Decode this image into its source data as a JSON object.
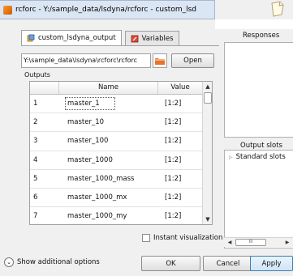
{
  "window": {
    "title": "rcforc - Y:/sample_data/lsdyna/rcforc - custom_lsd"
  },
  "tabs": [
    {
      "label": "custom_lsdyna_output",
      "icon": "output-icon"
    },
    {
      "label": "Variables",
      "icon": "variables-icon"
    }
  ],
  "file": {
    "path": "Y:\\sample_data\\lsdyna\\rcforc\\rcforc",
    "open_label": "Open"
  },
  "outputs": {
    "label": "Outputs",
    "columns": [
      "Name",
      "Value"
    ],
    "rows": [
      {
        "num": "1",
        "name": "master_1",
        "value": "[1:2]"
      },
      {
        "num": "2",
        "name": "master_10",
        "value": "[1:2]"
      },
      {
        "num": "3",
        "name": "master_100",
        "value": "[1:2]"
      },
      {
        "num": "4",
        "name": "master_1000",
        "value": "[1:2]"
      },
      {
        "num": "5",
        "name": "master_1000_mass",
        "value": "[1:2]"
      },
      {
        "num": "6",
        "name": "master_1000_mx",
        "value": "[1:2]"
      },
      {
        "num": "7",
        "name": "master_1000_my",
        "value": "[1:2]"
      }
    ]
  },
  "instant_visualization": {
    "label": "Instant visualization",
    "checked": false
  },
  "footer": {
    "show_options_label": "Show additional options",
    "ok_label": "OK",
    "cancel_label": "Cancel",
    "apply_label": "Apply"
  },
  "responses": {
    "label": "Responses"
  },
  "output_slots": {
    "label": "Output slots",
    "items": [
      {
        "label": "Standard slots"
      }
    ],
    "scroll_thumb_label": "III"
  },
  "colors": {
    "titlebar": "#dbe6f4",
    "apply_border": "#3c7fb1",
    "folder_icon": "#e8742a"
  }
}
